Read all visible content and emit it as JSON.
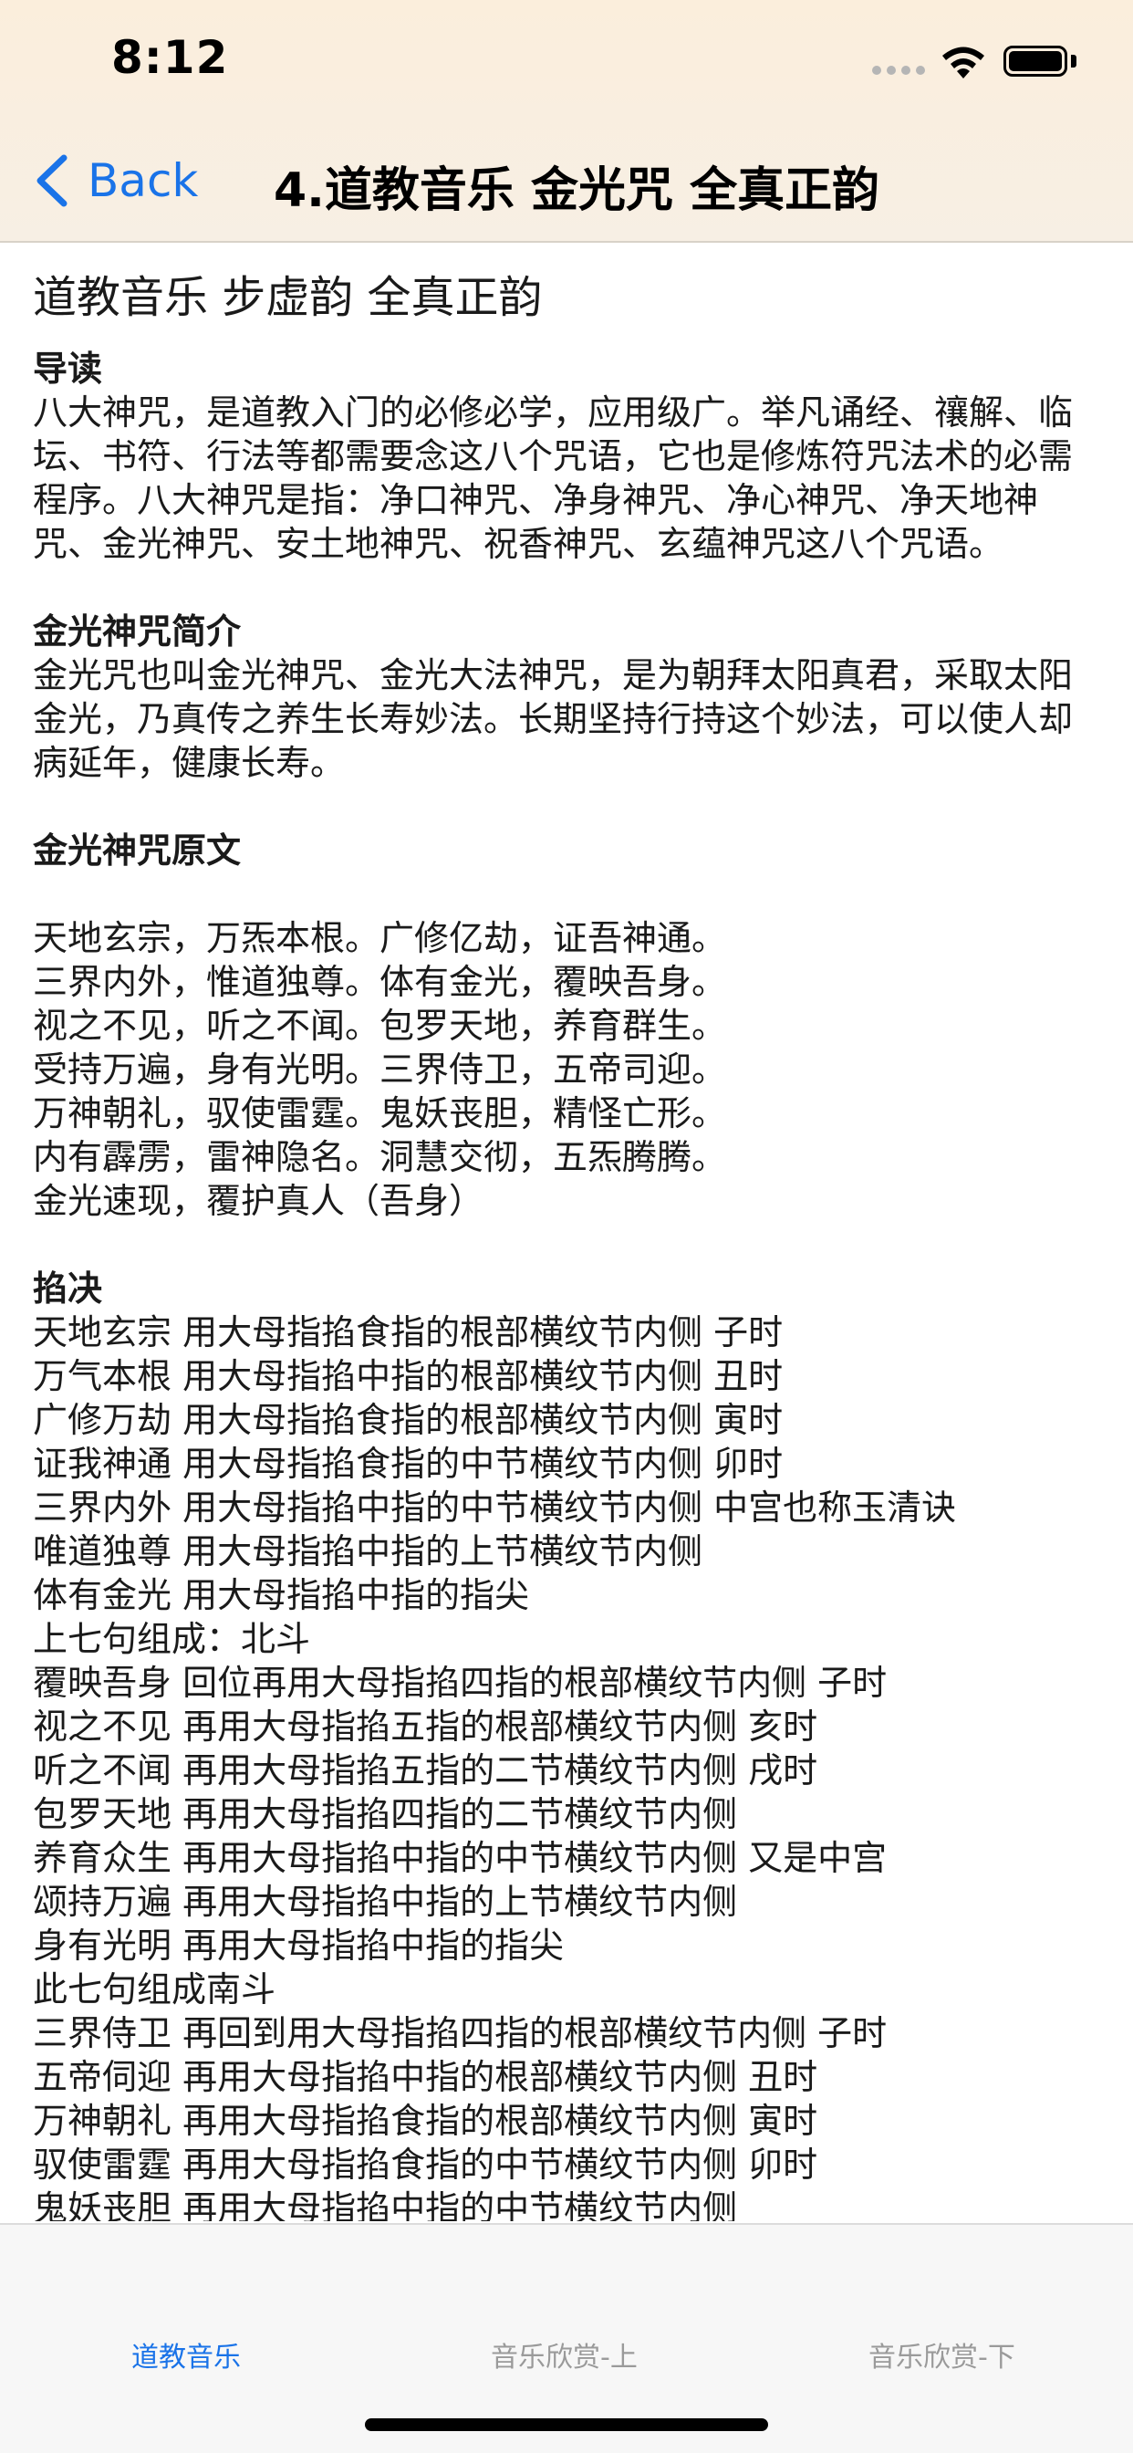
{
  "status": {
    "time": "8:12"
  },
  "nav": {
    "back_label": "Back",
    "title": "4.道教音乐 金光咒 全真正韵"
  },
  "article": {
    "heading": "道教音乐 步虚韵 全真正韵",
    "intro": {
      "title": "导读",
      "text": "八大神咒，是道教入门的必修必学，应用级广。举凡诵经、禳解、临坛、书符、行法等都需要念这八个咒语，它也是修炼符咒法术的必需程序。八大神咒是指：净口神咒、净身神咒、净心神咒、净天地神咒、金光神咒、安土地神咒、祝香神咒、玄蕴神咒这八个咒语。"
    },
    "brief": {
      "title": "金光神咒简介",
      "text": "金光咒也叫金光神咒、金光大法神咒，是为朝拜太阳真君，采取太阳金光，乃真传之养生长寿妙法。长期坚持行持这个妙法，可以使人却病延年，健康长寿。"
    },
    "original": {
      "title": "金光神咒原文",
      "lines": [
        "天地玄宗，万炁本根。广修亿劫，证吾神通。",
        "三界内外，惟道独尊。体有金光，覆映吾身。",
        "视之不见，听之不闻。包罗天地，养育群生。",
        "受持万遍，身有光明。三界侍卫，五帝司迎。",
        "万神朝礼，驭使雷霆。鬼妖丧胆，精怪亡形。",
        "内有霹雳，雷神隐名。洞慧交彻，五炁腾腾。",
        "金光速现，覆护真人（吾身）"
      ]
    },
    "mudra": {
      "title": "掐决",
      "lines": [
        "天地玄宗 用大母指掐食指的根部横纹节内侧 子时",
        "万气本根 用大母指掐中指的根部横纹节内侧 丑时",
        "广修万劫 用大母指掐食指的根部横纹节内侧 寅时",
        "证我神通 用大母指掐食指的中节横纹节内侧 卯时",
        "三界内外 用大母指掐中指的中节横纹节内侧 中宫也称玉清诀",
        "唯道独尊 用大母指掐中指的上节横纹节内侧",
        "体有金光 用大母指掐中指的指尖",
        "上七句组成：北斗",
        "覆映吾身 回位再用大母指掐四指的根部横纹节内侧 子时",
        "视之不见 再用大母指掐五指的根部横纹节内侧 亥时",
        "听之不闻 再用大母指掐五指的二节横纹节内侧 戌时",
        "包罗天地 再用大母指掐四指的二节横纹节内侧",
        "养育众生 再用大母指掐中指的中节横纹节内侧 又是中宫",
        "颂持万遍 再用大母指掐中指的上节横纹节内侧",
        "身有光明 再用大母指掐中指的指尖",
        "此七句组成南斗",
        "三界侍卫 再回到用大母指掐四指的根部横纹节内侧 子时",
        "五帝伺迎 再用大母指掐中指的根部横纹节内侧 丑时",
        "万神朝礼 再用大母指掐食指的根部横纹节内侧 寅时",
        "驭使雷霆 再用大母指掐食指的中节横纹节内侧 卯时",
        "鬼妖丧胆 再用大母指掐中指的中节横纹节内侧"
      ]
    }
  },
  "tabs": [
    {
      "label": "道教音乐",
      "active": true
    },
    {
      "label": "音乐欣赏-上",
      "active": false
    },
    {
      "label": "音乐欣赏-下",
      "active": false
    }
  ],
  "colors": {
    "accent": "#1a73e8",
    "inactive_tab": "#9a9a9a",
    "header_bg": "#f9efe2"
  },
  "icons": {
    "back": "chevron-left-icon",
    "wifi": "wifi-icon",
    "battery": "battery-icon",
    "signal": "cellular-signal-icon"
  }
}
